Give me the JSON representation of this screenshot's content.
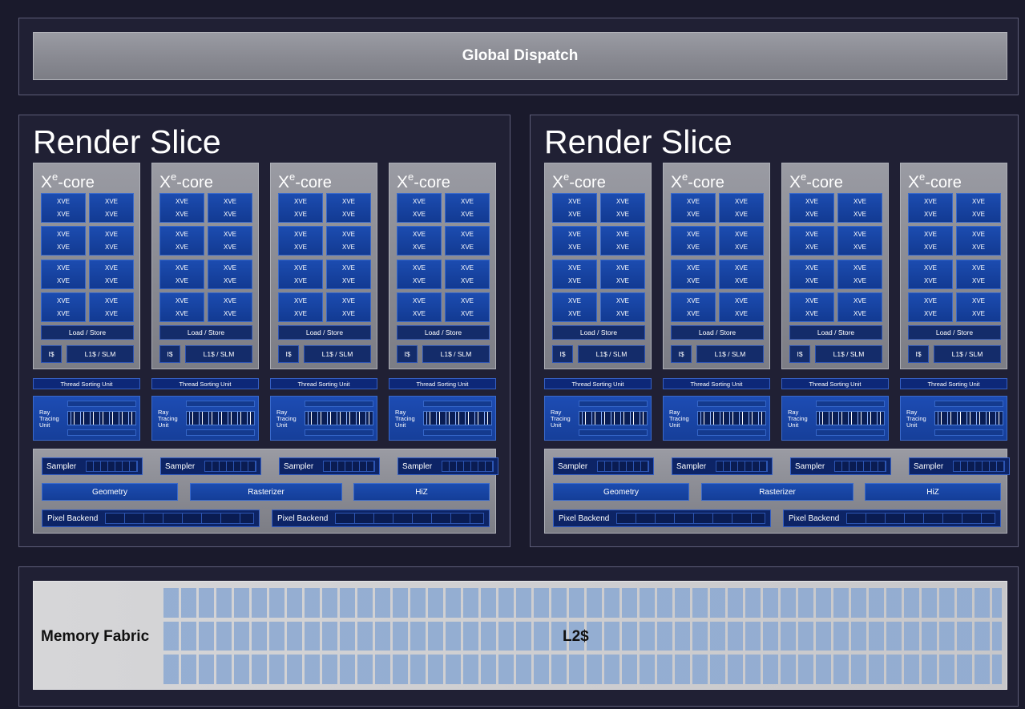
{
  "global_dispatch": {
    "label": "Global Dispatch"
  },
  "slices": [
    {
      "title": "Render Slice",
      "cores": [
        {
          "prefix": "X",
          "sup": "e",
          "suffix": "-core",
          "xve_label": "XVE",
          "load_store": "Load / Store",
          "icache": "I$",
          "l1": "L1$ / SLM",
          "tsu": "Thread Sorting Unit",
          "rtu": "Ray Tracing Unit",
          "sampler": "Sampler"
        },
        {
          "prefix": "X",
          "sup": "e",
          "suffix": "-core",
          "xve_label": "XVE",
          "load_store": "Load / Store",
          "icache": "I$",
          "l1": "L1$ / SLM",
          "tsu": "Thread Sorting Unit",
          "rtu": "Ray Tracing Unit",
          "sampler": "Sampler"
        },
        {
          "prefix": "X",
          "sup": "e",
          "suffix": "-core",
          "xve_label": "XVE",
          "load_store": "Load / Store",
          "icache": "I$",
          "l1": "L1$ / SLM",
          "tsu": "Thread Sorting Unit",
          "rtu": "Ray Tracing Unit",
          "sampler": "Sampler"
        },
        {
          "prefix": "X",
          "sup": "e",
          "suffix": "-core",
          "xve_label": "XVE",
          "load_store": "Load / Store",
          "icache": "I$",
          "l1": "L1$ / SLM",
          "tsu": "Thread Sorting Unit",
          "rtu": "Ray Tracing Unit",
          "sampler": "Sampler"
        }
      ],
      "geometry": "Geometry",
      "rasterizer": "Rasterizer",
      "hiz": "HiZ",
      "pixel_backends": [
        "Pixel Backend",
        "Pixel Backend"
      ]
    },
    {
      "title": "Render Slice",
      "cores": [
        {
          "prefix": "X",
          "sup": "e",
          "suffix": "-core",
          "xve_label": "XVE",
          "load_store": "Load / Store",
          "icache": "I$",
          "l1": "L1$ / SLM",
          "tsu": "Thread Sorting Unit",
          "rtu": "Ray Tracing Unit",
          "sampler": "Sampler"
        },
        {
          "prefix": "X",
          "sup": "e",
          "suffix": "-core",
          "xve_label": "XVE",
          "load_store": "Load / Store",
          "icache": "I$",
          "l1": "L1$ / SLM",
          "tsu": "Thread Sorting Unit",
          "rtu": "Ray Tracing Unit",
          "sampler": "Sampler"
        },
        {
          "prefix": "X",
          "sup": "e",
          "suffix": "-core",
          "xve_label": "XVE",
          "load_store": "Load / Store",
          "icache": "I$",
          "l1": "L1$ / SLM",
          "tsu": "Thread Sorting Unit",
          "rtu": "Ray Tracing Unit",
          "sampler": "Sampler"
        },
        {
          "prefix": "X",
          "sup": "e",
          "suffix": "-core",
          "xve_label": "XVE",
          "load_store": "Load / Store",
          "icache": "I$",
          "l1": "L1$ / SLM",
          "tsu": "Thread Sorting Unit",
          "rtu": "Ray Tracing Unit",
          "sampler": "Sampler"
        }
      ],
      "geometry": "Geometry",
      "rasterizer": "Rasterizer",
      "hiz": "HiZ",
      "pixel_backends": [
        "Pixel Backend",
        "Pixel Backend"
      ]
    }
  ],
  "memory": {
    "fabric_label": "Memory Fabric",
    "l2_label": "L2$"
  }
}
